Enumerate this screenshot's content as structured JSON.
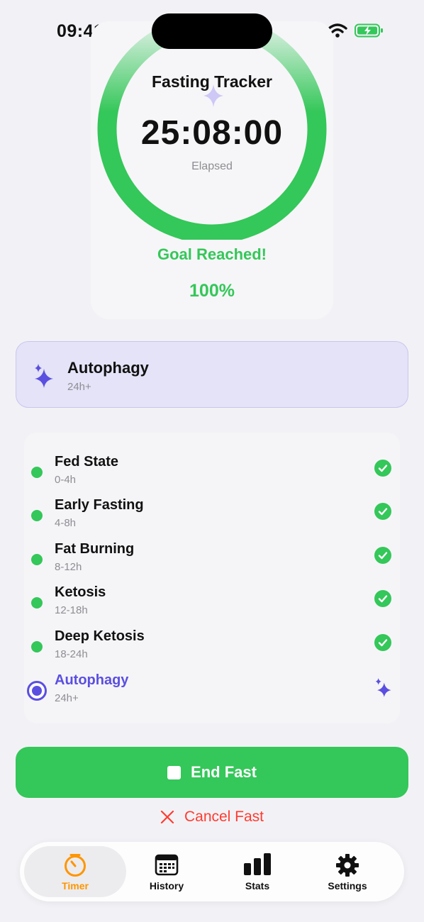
{
  "status_bar": {
    "time": "09:41"
  },
  "app": {
    "title": "Fasting Tracker"
  },
  "timer": {
    "elapsed": "25:08:00",
    "elapsed_label": "Elapsed",
    "goal_text": "Goal Reached!",
    "percent_text": "100%",
    "progress": 1.0
  },
  "current_phase": {
    "name": "Autophagy",
    "range": "24h+"
  },
  "phases": [
    {
      "name": "Fed State",
      "range": "0-4h",
      "status": "complete"
    },
    {
      "name": "Early Fasting",
      "range": "4-8h",
      "status": "complete"
    },
    {
      "name": "Fat Burning",
      "range": "8-12h",
      "status": "complete"
    },
    {
      "name": "Ketosis",
      "range": "12-18h",
      "status": "complete"
    },
    {
      "name": "Deep Ketosis",
      "range": "18-24h",
      "status": "complete"
    },
    {
      "name": "Autophagy",
      "range": "24h+",
      "status": "current"
    }
  ],
  "actions": {
    "end_label": "End Fast",
    "cancel_label": "Cancel Fast"
  },
  "tabs": [
    {
      "label": "Timer",
      "icon": "timer-icon",
      "active": true
    },
    {
      "label": "History",
      "icon": "calendar-icon",
      "active": false
    },
    {
      "label": "Stats",
      "icon": "chart-icon",
      "active": false
    },
    {
      "label": "Settings",
      "icon": "gear-icon",
      "active": false
    }
  ],
  "colors": {
    "accent_green": "#34c759",
    "accent_purple": "#5b4fe0",
    "danger": "#ff3b30",
    "tab_active": "#ff9500"
  }
}
